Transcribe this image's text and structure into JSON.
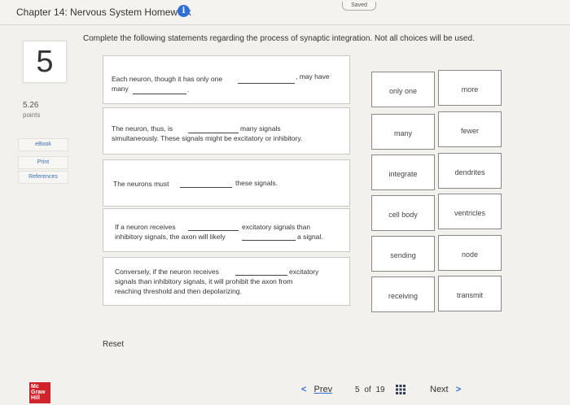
{
  "header": {
    "title": "Chapter 14: Nervous System Homework",
    "info_icon": "i",
    "status": "Saved"
  },
  "question": {
    "number": "5",
    "points_value": "5.26",
    "points_label": "points",
    "instructions": "Complete the following statements regarding the process of synaptic integration. Not all choices will be used."
  },
  "sidebar": {
    "ebook": "eBook",
    "print": "Print",
    "references": "References"
  },
  "statements": [
    {
      "line1a": "Each neuron, though it has only one",
      "line1b": ", may have",
      "line2a": "many",
      "line2b": "."
    },
    {
      "line1a": "The neuron, thus, is",
      "line1b": "many signals",
      "line2a": "simultaneously. These signals might be excitatory or inhibitory."
    },
    {
      "line1a": "The neurons must",
      "line1b": "these signals."
    },
    {
      "line1a": "If a neuron receives",
      "line1b": "excitatory signals than",
      "line2a": "inhibitory signals, the axon will likely",
      "line2b": "a signal."
    },
    {
      "line1a": "Conversely, if the neuron receives",
      "line1b": "excitatory",
      "line2a": "signals than inhibitory signals, it will prohibit the axon from",
      "line3a": "reaching threshold and then depolarizing."
    }
  ],
  "choices": [
    {
      "left": "only one",
      "right": "more"
    },
    {
      "left": "many",
      "right": "fewer"
    },
    {
      "left": "integrate",
      "right": "dendrites"
    },
    {
      "left": "cell body",
      "right": "ventricles"
    },
    {
      "left": "sending",
      "right": "node"
    },
    {
      "left": "receiving",
      "right": "transmit"
    }
  ],
  "reset_label": "Reset",
  "logo": {
    "line1": "Mc",
    "line2": "Graw",
    "line3": "Hill"
  },
  "footer": {
    "prev_chevron": "<",
    "prev_label": "Prev",
    "page_current": "5",
    "page_of": "of",
    "page_total": "19",
    "next_label": "Next",
    "next_chevron": ">"
  }
}
